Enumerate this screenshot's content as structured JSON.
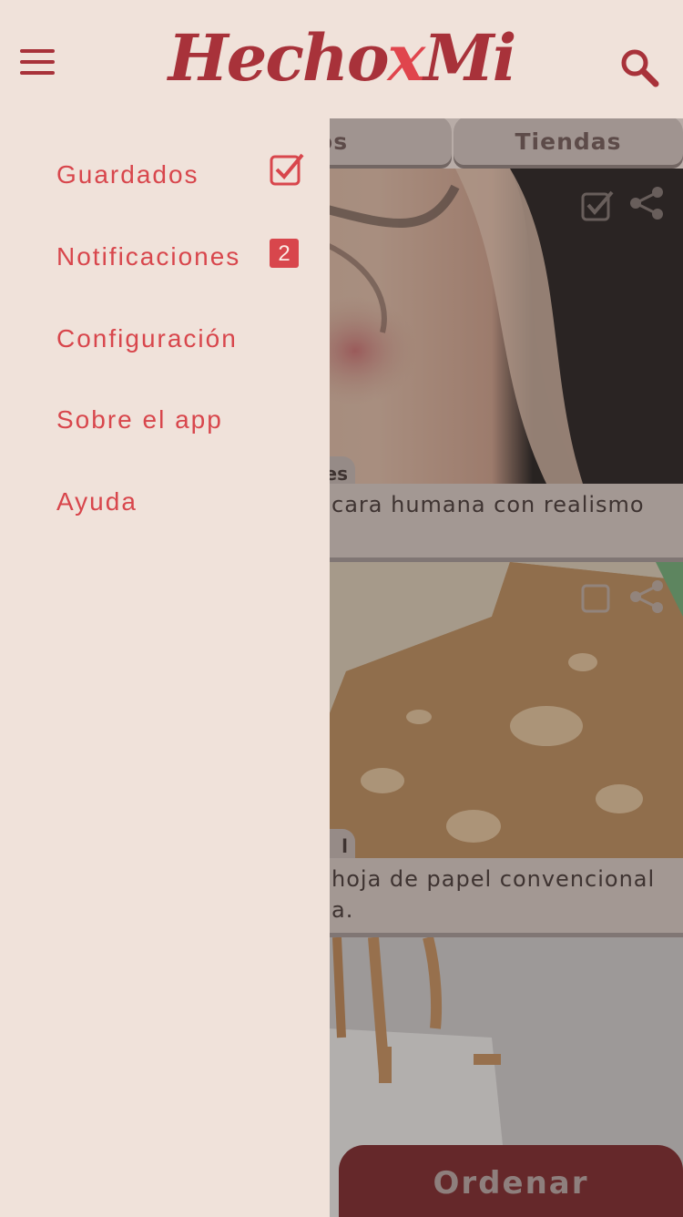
{
  "header": {
    "logo_main": "Hecho",
    "logo_x": "x",
    "logo_end": "Mi",
    "menu_icon": "hamburger-menu-icon",
    "search_icon": "search-icon"
  },
  "tabs": [
    {
      "label": "culos"
    },
    {
      "label": "Tiendas"
    }
  ],
  "cards": [
    {
      "category": "es",
      "text": "cara humana con realismo"
    },
    {
      "category": "l",
      "text": "hoja de papel convencional",
      "text2": "a."
    }
  ],
  "order_button": {
    "label": "Ordenar"
  },
  "drawer": {
    "items": [
      {
        "label": "Guardados",
        "icon": "checkbox-checked-icon"
      },
      {
        "label": "Notificaciones",
        "badge": "2"
      },
      {
        "label": "Configuración"
      },
      {
        "label": "Sobre el app"
      },
      {
        "label": "Ayuda"
      }
    ]
  },
  "colors": {
    "accent": "#d8464c",
    "brand_dark": "#a8323a",
    "background": "#f0e2da",
    "button": "#762022"
  }
}
